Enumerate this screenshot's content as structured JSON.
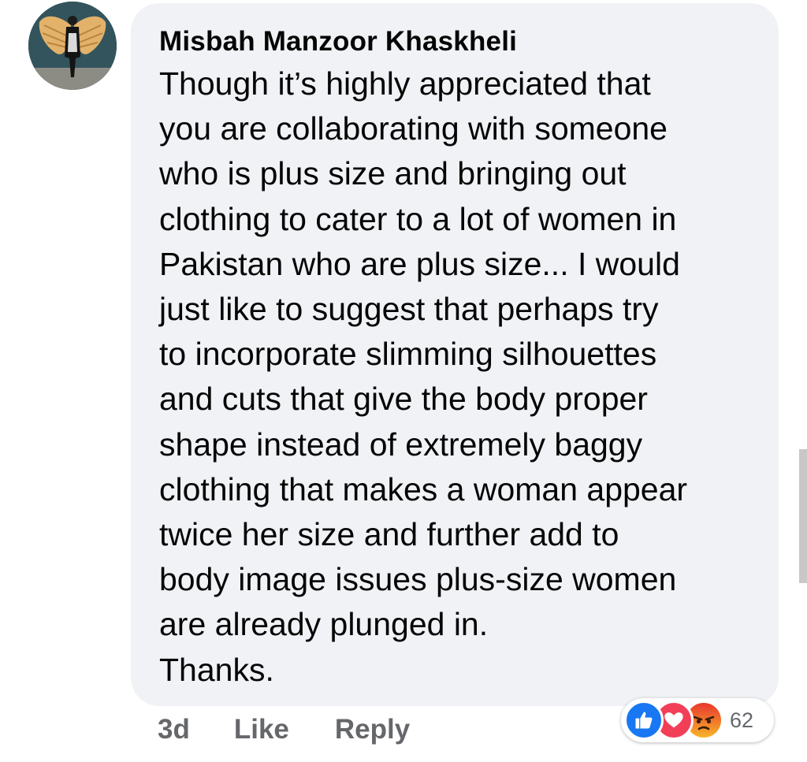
{
  "comment": {
    "author": "Misbah Manzoor Khaskheli",
    "text": "Though it’s highly appreciated that\nyou are collaborating with someone\nwho is plus size and bringing out\nclothing to cater to a lot of women in\nPakistan who are plus size... I would\njust like to suggest that perhaps try\nto incorporate slimming silhouettes\nand cuts that give the body proper\nshape instead of extremely baggy\nclothing that makes a woman appear\ntwice her size and further add to\nbody image issues plus-size women\nare already plunged in.\nThanks.",
    "timestamp": "3d",
    "like_label": "Like",
    "reply_label": "Reply"
  },
  "reactions": {
    "icons": [
      "like-icon",
      "love-icon",
      "angry-icon"
    ],
    "count": "62"
  },
  "colors": {
    "bubble_bg": "#f0f2f5",
    "text": "#050505",
    "meta": "#65676b",
    "like_blue": "#1877f2",
    "love_red": "#f33e58",
    "angry_orange": "#f7b125"
  }
}
